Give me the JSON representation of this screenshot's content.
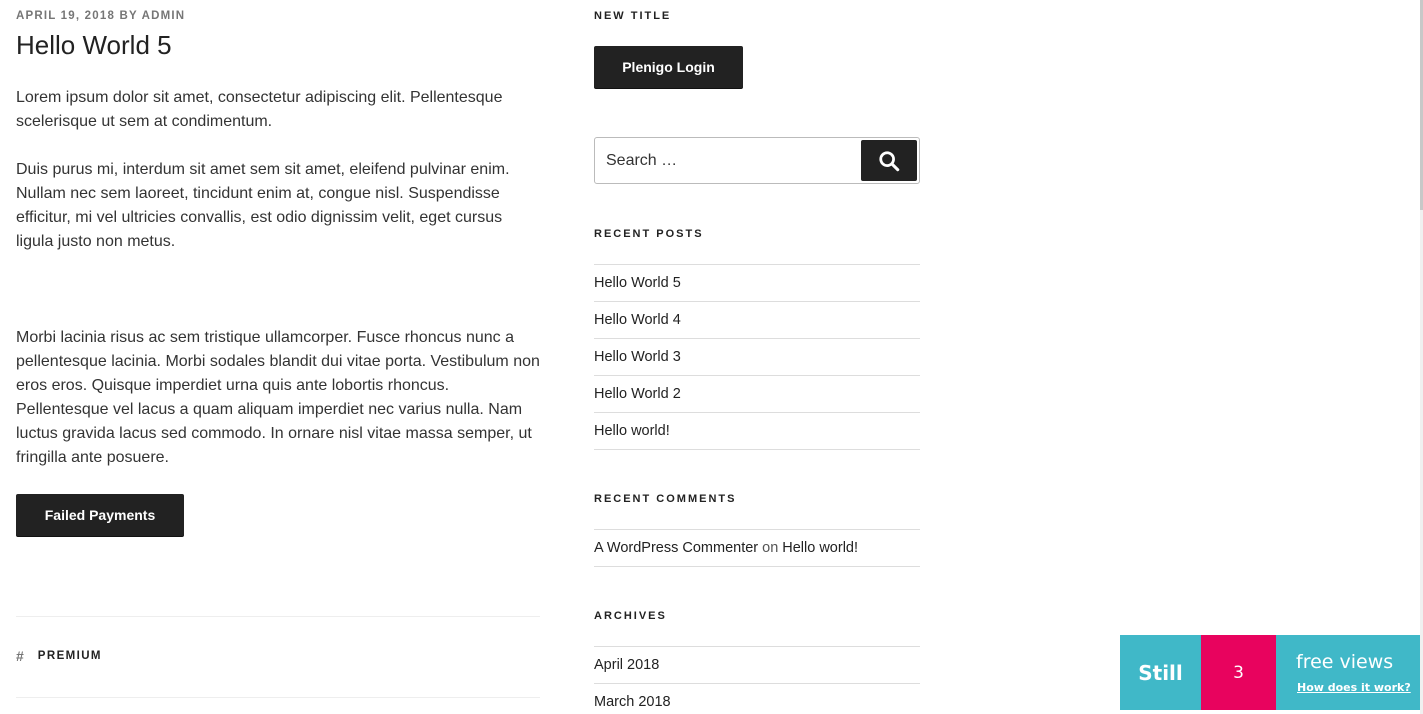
{
  "post": {
    "date": "APRIL 19, 2018",
    "by": "BY",
    "author": "ADMIN",
    "title": "Hello World 5",
    "paragraphs": [
      "Lorem ipsum dolor sit amet, consectetur adipiscing elit. Pellentesque scelerisque ut sem at condimentum.",
      "Duis purus mi, interdum sit amet sem sit amet, eleifend pulvinar enim. Nullam nec sem laoreet, tincidunt enim at, congue nisl. Suspendisse efficitur, mi vel ultricies convallis, est odio dignissim velit, eget cursus ligula justo non metus.",
      "Morbi lacinia risus ac sem tristique ullamcorper. Fusce rhoncus nunc a pellentesque lacinia. Morbi sodales blandit dui vitae porta. Vestibulum non eros eros. Quisque imperdiet urna quis ante lobortis rhoncus. Pellentesque vel lacus a quam aliquam imperdiet nec varius nulla. Nam luctus gravida lacus sed commodo. In ornare nisl vitae massa semper, ut fringilla ante posuere."
    ],
    "failed_payments_label": "Failed Payments",
    "tag_hash": "#",
    "tag": "PREMIUM"
  },
  "sidebar": {
    "new_title": "NEW TITLE",
    "login_label": "Plenigo Login",
    "search": {
      "placeholder": "Search …",
      "icon": "search-icon"
    },
    "recent_posts": {
      "title": "RECENT POSTS",
      "items": [
        "Hello World 5",
        "Hello World 4",
        "Hello World 3",
        "Hello World 2",
        "Hello world!"
      ]
    },
    "recent_comments": {
      "title": "RECENT COMMENTS",
      "items": [
        {
          "author": "A WordPress Commenter",
          "on": "on",
          "post": "Hello world!"
        }
      ]
    },
    "archives": {
      "title": "ARCHIVES",
      "items": [
        "April 2018",
        "March 2018"
      ]
    }
  },
  "views_banner": {
    "still": "Still",
    "count": "3",
    "label": "free views",
    "link": "How does it work?"
  },
  "colors": {
    "dark_button": "#222222",
    "banner_teal": "#40b8c8",
    "banner_pink": "#e8035e",
    "text": "#333333"
  }
}
